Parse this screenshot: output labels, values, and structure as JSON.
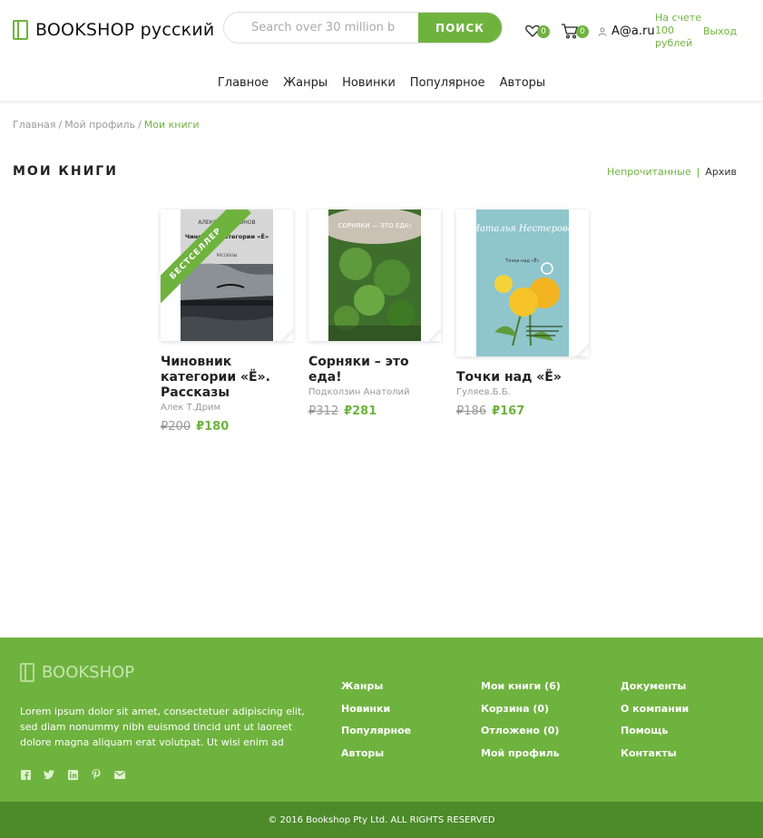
{
  "header": {
    "logo_text": "BOOKSHOP русский",
    "search_placeholder": "Search over 30 million b",
    "search_button": "ПОИСК",
    "favorites_count": "0",
    "cart_count": "0",
    "user_name": "A@a.ru",
    "balance": "На счете 100 рублей",
    "logout": "Выход"
  },
  "nav": [
    "Главное",
    "Жанры",
    "Новинки",
    "Популярное",
    "Авторы"
  ],
  "breadcrumb": {
    "home": "Главная",
    "profile": "Мой профиль",
    "current": "Мои книги"
  },
  "page": {
    "title": "МОИ КНИГИ",
    "filter_unread": "Непрочитанные",
    "filter_sep": "|",
    "filter_archive": "Архив"
  },
  "books": [
    {
      "title": "Чиновник категории «Ё». Рассказы",
      "author": "Алек Т.Дрим",
      "old_price": "₽200",
      "new_price": "₽180",
      "badge": "БЕСТСЕЛЛЕР",
      "cover_author": "АЛЕКСЕЙ ЛИМОНОВ",
      "cover_title": "Чиновник категории «Ё»",
      "cover_sub": "РАССКАЗЫ"
    },
    {
      "title": "Сорняки – это еда!",
      "author": "Подколзин Анатолий",
      "old_price": "₽312",
      "new_price": "₽281",
      "cover_title": "СОРНЯКИ — ЭТО ЕДА!"
    },
    {
      "title": "Точки над «Ё»",
      "author": "Гуляев.Б.Б.",
      "old_price": "₽186",
      "new_price": "₽167",
      "cover_author": "Наталья Нестерова",
      "cover_title": "Точки над «Ё»"
    }
  ],
  "footer": {
    "logo_text": "BOOKSHOP",
    "text": "Lorem ipsum dolor sit amet, consectetuer adipiscing elit, sed diam nonummy nibh euismod tincid unt ut laoreet dolore magna aliquam erat volutpat. Ut wisi enim ad",
    "col1": [
      "Жанры",
      "Новинки",
      "Популярное",
      "Авторы"
    ],
    "col2": [
      "Мои книги (6)",
      "Корзина (0)",
      "Отложено (0)",
      "Мой профиль"
    ],
    "col3": [
      "Документы",
      "О компании",
      "Помощь",
      "Контакты"
    ],
    "socials": [
      "facebook-icon",
      "twitter-icon",
      "linkedin-icon",
      "pinterest-icon",
      "mail-icon"
    ],
    "copyright": "© 2016 Bookshop Pty Ltd. ALL RIGHTS RESERVED"
  },
  "colors": {
    "accent": "#6fb33f",
    "footer_bottom": "#4c8a2a"
  }
}
